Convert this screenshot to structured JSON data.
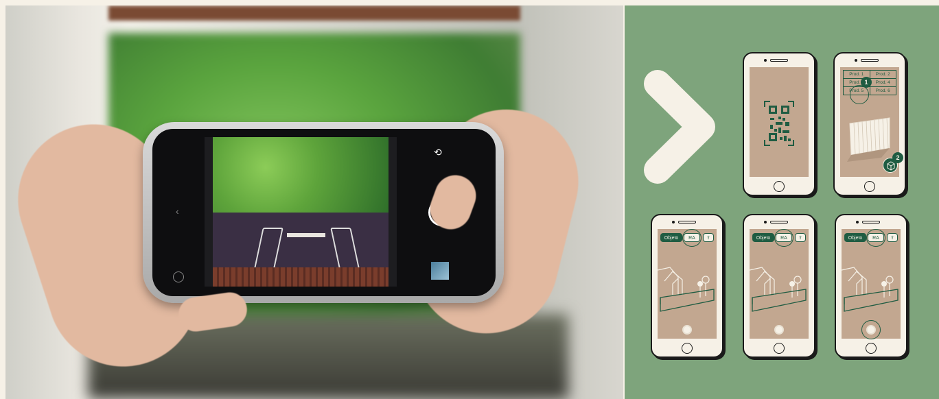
{
  "mockups": {
    "phone2": {
      "products": [
        "Prod. 1",
        "Prod. 2",
        "Prod. 3",
        "Prod. 4",
        "Prod. 5",
        "Prod. 6"
      ],
      "badge1": "1",
      "badge2": "2"
    },
    "phone3": {
      "tab_object": "Objeto",
      "tab_ar": "RA"
    },
    "phone4": {
      "tab_object": "Objeto",
      "tab_ar": "RA"
    },
    "phone5": {
      "tab_object": "Objeto",
      "tab_ar": "RA"
    }
  },
  "colors": {
    "panel_green": "#7ea47c",
    "dark_green": "#1f5c42",
    "cream": "#f6f1e7",
    "screen_tan": "#c2a790"
  },
  "icons": [
    "chevron-right-icon",
    "qr-code-icon",
    "cube-icon",
    "share-icon",
    "shutter-icon"
  ]
}
